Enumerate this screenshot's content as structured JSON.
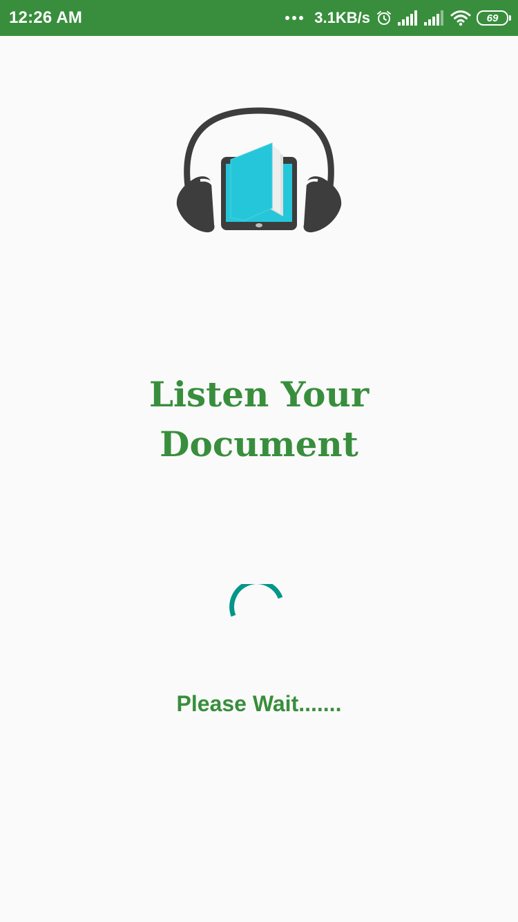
{
  "status_bar": {
    "time": "12:26 AM",
    "network_speed": "3.1KB/s",
    "battery_level": "69",
    "icons": [
      "more-dots-icon",
      "alarm-icon",
      "signal-icon",
      "signal-icon",
      "wifi-icon",
      "battery-icon"
    ]
  },
  "colors": {
    "status_bar_bg": "#388e3c",
    "accent_green": "#388e3c",
    "spinner_color": "#009688",
    "logo_dark": "#3d3d3d",
    "logo_book": "#26c6da"
  },
  "splash": {
    "logo_icon": "headphones-book-logo-icon",
    "title_line1": "Listen Your",
    "title_line2": "Document",
    "loading_text": "Please Wait......."
  }
}
